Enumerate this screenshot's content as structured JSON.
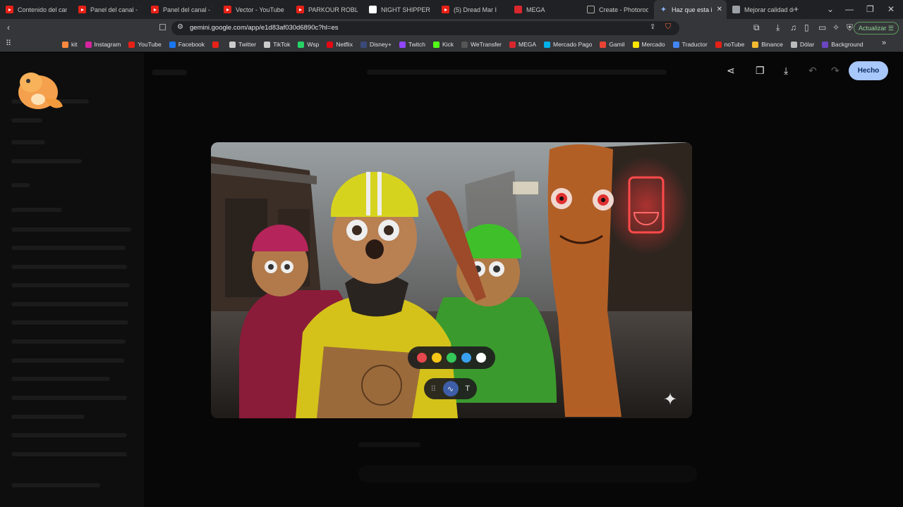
{
  "browser": {
    "tabs": [
      {
        "label": "Contenido del cana",
        "icon": "youtube-icon"
      },
      {
        "label": "Panel del canal - Yo",
        "icon": "youtube-icon"
      },
      {
        "label": "Panel del canal - Yo",
        "icon": "youtube-icon"
      },
      {
        "label": "Vector - YouTube",
        "icon": "youtube-icon"
      },
      {
        "label": "PARKOUR ROBLOX",
        "icon": "youtube-icon"
      },
      {
        "label": "NIGHT SHIPPERS -",
        "icon": "google-icon"
      },
      {
        "label": "(5) Dread Mar I",
        "icon": "youtube-icon"
      },
      {
        "label": "MEGA",
        "icon": "mega-icon"
      },
      {
        "label": "Create - Photoroon",
        "icon": "photoroom-icon"
      },
      {
        "label": "Haz que esta i",
        "icon": "gemini-icon",
        "active": true
      },
      {
        "label": "Mejorar calidad de",
        "icon": "globe-icon"
      }
    ],
    "url": "gemini.google.com/app/e1d83af030d6890c?hl=es",
    "update_label": "Actualizar",
    "bookmarks": [
      {
        "label": "kit",
        "color": "#ff8a3d"
      },
      {
        "label": "Instagram",
        "color": "#d6249f"
      },
      {
        "label": "YouTube",
        "color": "#e62117"
      },
      {
        "label": "Facebook",
        "color": "#1877f2"
      },
      {
        "label": "",
        "color": "#e62117"
      },
      {
        "label": "Twitter",
        "color": "#cccccc"
      },
      {
        "label": "TikTok",
        "color": "#cccccc"
      },
      {
        "label": "Wsp",
        "color": "#25d366"
      },
      {
        "label": "Netflix",
        "color": "#e50914"
      },
      {
        "label": "Disney+",
        "color": "#3b4a7a"
      },
      {
        "label": "Twitch",
        "color": "#9146ff"
      },
      {
        "label": "Kick",
        "color": "#53fc18"
      },
      {
        "label": "WeTransfer",
        "color": "#555555"
      },
      {
        "label": "MEGA",
        "color": "#d9272e"
      },
      {
        "label": "Mercado Pago",
        "color": "#00b1ea"
      },
      {
        "label": "Gamil",
        "color": "#ea4335"
      },
      {
        "label": "Mercado",
        "color": "#ffe600"
      },
      {
        "label": "Traductor",
        "color": "#4285f4"
      },
      {
        "label": "noTube",
        "color": "#e62117"
      },
      {
        "label": "Binance",
        "color": "#f3ba2f"
      },
      {
        "label": "Dólar",
        "color": "#bbbbbb"
      },
      {
        "label": "Background",
        "color": "#6b46c1"
      }
    ]
  },
  "editor": {
    "done_label": "Hecho",
    "palette": [
      "#e5484d",
      "#f5c518",
      "#34c759",
      "#3aa0f0",
      "#ffffff"
    ],
    "tools": {
      "text_tool": "T"
    }
  },
  "colors": {
    "accent": "#a8c7fa",
    "active_tool": "#3e5ea8"
  }
}
